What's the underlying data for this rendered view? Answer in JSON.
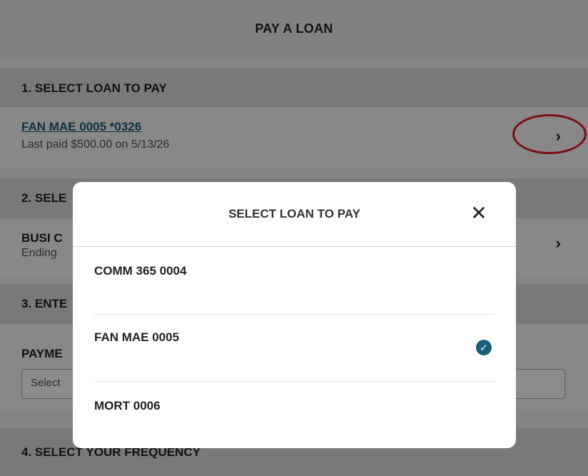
{
  "header": {
    "title": "PAY A LOAN"
  },
  "sections": [
    {
      "label": "1. SELECT LOAN TO PAY"
    },
    {
      "label": "2. SELE"
    },
    {
      "label": "3. ENTE"
    },
    {
      "label": "4. SELECT YOUR FREQUENCY"
    }
  ],
  "loan": {
    "name": "FAN MAE 0005 *0326",
    "detail": "Last paid $500.00 on 5/13/26"
  },
  "account": {
    "name": "BUSI C",
    "detail": "Ending"
  },
  "payment": {
    "label": "PAYME",
    "placeholder": "Select"
  },
  "icons": {
    "chevron": "chevron-right-icon",
    "close": "close-icon",
    "check": "check-circle-icon"
  },
  "modal": {
    "title": "SELECT LOAN TO PAY",
    "close_glyph": "✕",
    "options": [
      {
        "label": "COMM 365 0004",
        "selected": false
      },
      {
        "label": "FAN MAE 0005",
        "selected": true
      },
      {
        "label": "MORT 0006",
        "selected": false
      }
    ]
  },
  "colors": {
    "accent": "#1a5d7a",
    "highlight": "#e31b23"
  }
}
